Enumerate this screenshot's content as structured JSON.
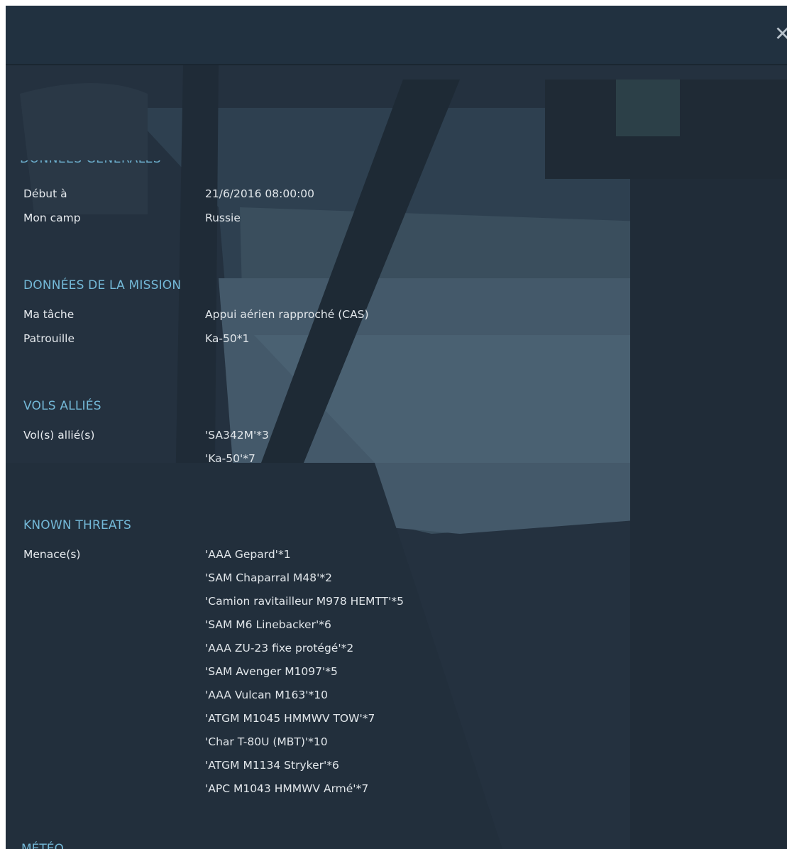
{
  "header": {
    "close_symbol": "✕"
  },
  "general": {
    "heading": "DONNÉES GÉNÉRALES",
    "rows": [
      {
        "label": "Début à",
        "value": "21/6/2016  08:00:00"
      },
      {
        "label": "Mon camp",
        "value": "Russie"
      }
    ]
  },
  "mission": {
    "heading": "DONNÉES DE LA MISSION",
    "rows": [
      {
        "label": "Ma tâche",
        "value": "Appui aérien rapproché (CAS)"
      },
      {
        "label": "Patrouille",
        "value": "Ka-50*1"
      }
    ]
  },
  "allies": {
    "heading": "VOLS ALLIÉS",
    "label": "Vol(s) allié(s)",
    "items": [
      "'SA342M'*3",
      "'Ka-50'*7"
    ]
  },
  "threats": {
    "heading": "KNOWN THREATS",
    "label": "Menace(s)",
    "items": [
      "'AAA Gepard'*1",
      "'SAM Chaparral M48'*2",
      "'Camion ravitailleur M978 HEMTT'*5",
      "'SAM M6 Linebacker'*6",
      "'AAA ZU-23 fixe protégé'*2",
      "'SAM Avenger M1097'*5",
      "'AAA Vulcan M163'*10",
      "'ATGM M1045 HMMWV TOW'*7",
      "'Char T-80U (MBT)'*10",
      "'ATGM M1134 Stryker'*6",
      "'APC M1043 HMMWV Armé'*7"
    ]
  },
  "next_section": {
    "heading": "MÉTÉO"
  }
}
